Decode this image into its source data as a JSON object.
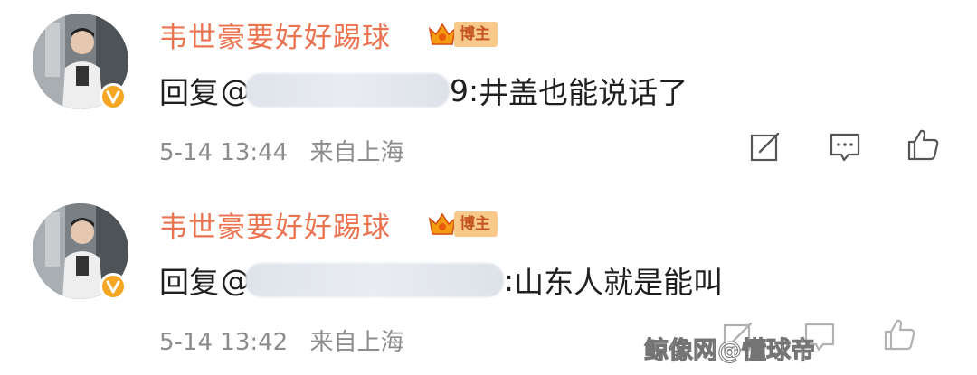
{
  "comments": [
    {
      "username": "韦世豪要好好踢球",
      "badge": "博主",
      "reply_prefix": "回复",
      "reply_at": "@",
      "reply_handle_tail": "9:",
      "reply_text": "井盖也能说话了",
      "time": "5-14 13:44",
      "source": "来自上海"
    },
    {
      "username": "韦世豪要好好踢球",
      "badge": "博主",
      "reply_prefix": "回复",
      "reply_at": "@",
      "reply_handle_tail": ":",
      "reply_text": "山东人就是能叫",
      "time": "5-14 13:42",
      "source": "来自上海"
    }
  ],
  "watermark": "鲸像网@懂球帝",
  "icons": {
    "edit": "edit-icon",
    "comment": "comment-icon",
    "like": "like-icon",
    "verified": "verified-v-icon",
    "crown": "crown-icon"
  },
  "colors": {
    "username": "#eb7350",
    "badge_bg": "#f7c98a",
    "badge_text": "#c4531f",
    "meta": "#8c8c8c",
    "verified": "#f5a623"
  }
}
